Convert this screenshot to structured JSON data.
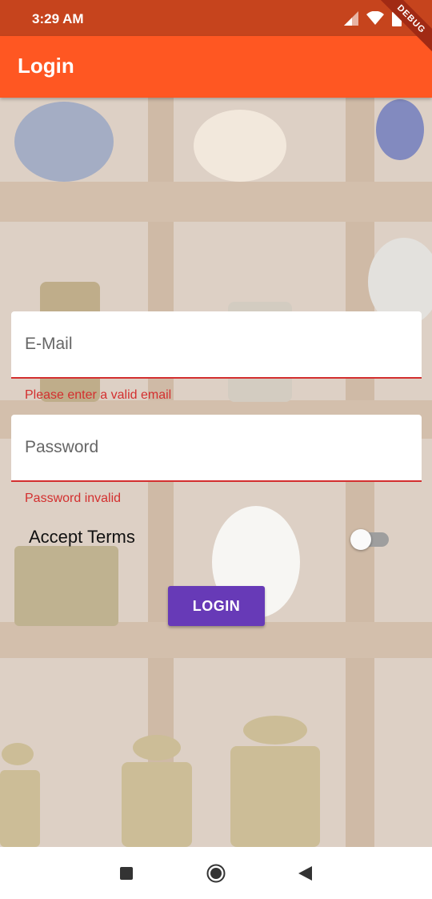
{
  "status_bar": {
    "time": "3:29 AM",
    "icons": [
      "signal-icon",
      "wifi-icon",
      "battery-icon"
    ]
  },
  "debug_banner": "DEBUG",
  "app_bar": {
    "title": "Login"
  },
  "form": {
    "email": {
      "placeholder": "E-Mail",
      "value": "",
      "error": "Please enter a valid email"
    },
    "password": {
      "placeholder": "Password",
      "value": "",
      "error": "Password invalid"
    },
    "terms": {
      "label": "Accept Terms",
      "enabled": false
    },
    "login_button": "LOGIN"
  },
  "nav_bar": {
    "buttons": [
      "recents-icon",
      "home-icon",
      "back-icon"
    ]
  },
  "colors": {
    "accent": "#ff5722",
    "status_bar": "#c6441d",
    "error": "#d32f2f",
    "button": "#673ab7"
  }
}
